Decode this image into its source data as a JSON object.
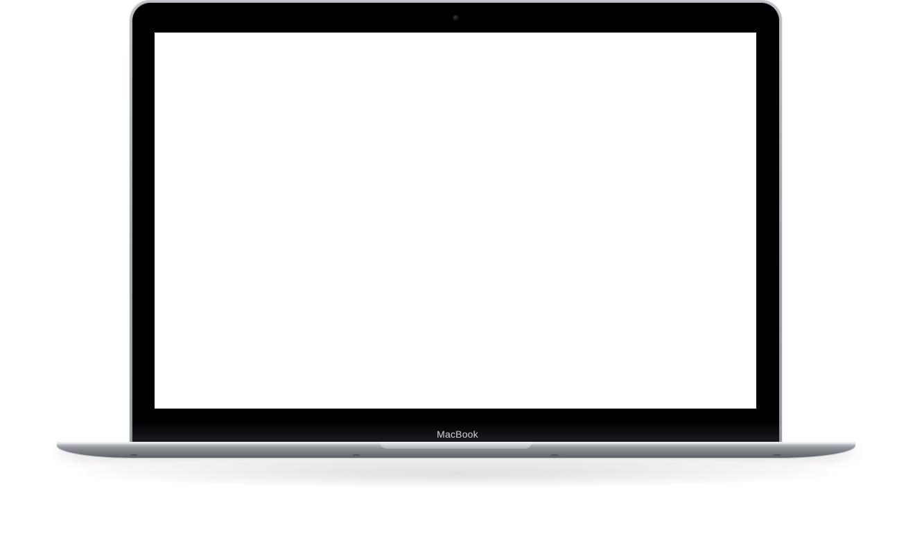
{
  "device": {
    "brand_label": "MacBook"
  },
  "colors": {
    "background": "#ffffff",
    "bezel": "#000000",
    "screen": "#ffffff",
    "aluminum": "#9aa0a7"
  },
  "icons": {
    "camera": "camera-icon"
  }
}
